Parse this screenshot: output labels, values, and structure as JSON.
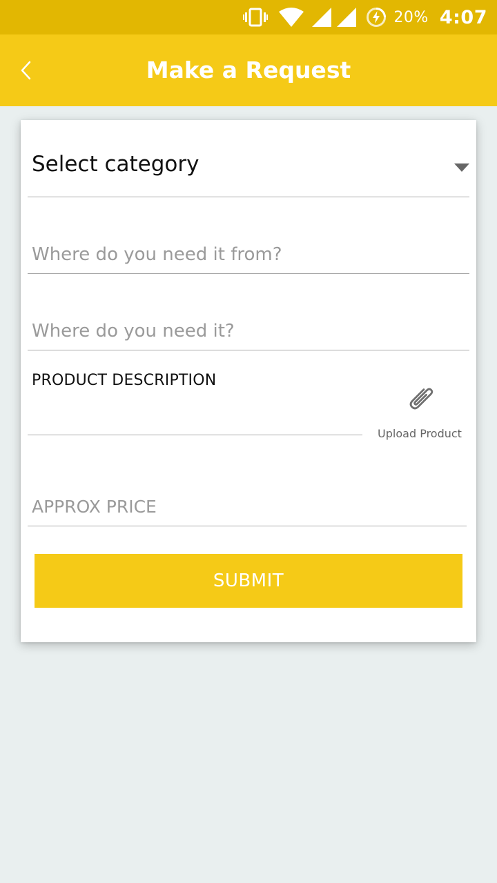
{
  "status_bar": {
    "icons": [
      "vibrate-icon",
      "wifi-icon",
      "signal-icon",
      "signal-icon",
      "battery-saver-icon"
    ],
    "battery_percent": "20%",
    "time": "4:07"
  },
  "app_bar": {
    "title": "Make a Request",
    "back_icon": "chevron-left-icon"
  },
  "form": {
    "category_select": {
      "label": "Select category",
      "caret_icon": "caret-down-icon"
    },
    "from_field": {
      "value": "",
      "placeholder": "Where do you need it from?"
    },
    "to_field": {
      "value": "",
      "placeholder": "Where do you need it?"
    },
    "description": {
      "label": "PRODUCT DESCRIPTION"
    },
    "upload": {
      "icon": "paperclip-icon",
      "label": "Upload Product"
    },
    "price_field": {
      "value": "",
      "placeholder": "APPROX PRICE"
    },
    "submit_label": "SUBMIT"
  },
  "colors": {
    "status_bar": "#e2b702",
    "brand": "#f5ca17",
    "background": "#e9efef",
    "card": "#ffffff",
    "divider": "#a9a9a9",
    "placeholder": "#9a9a9a"
  }
}
